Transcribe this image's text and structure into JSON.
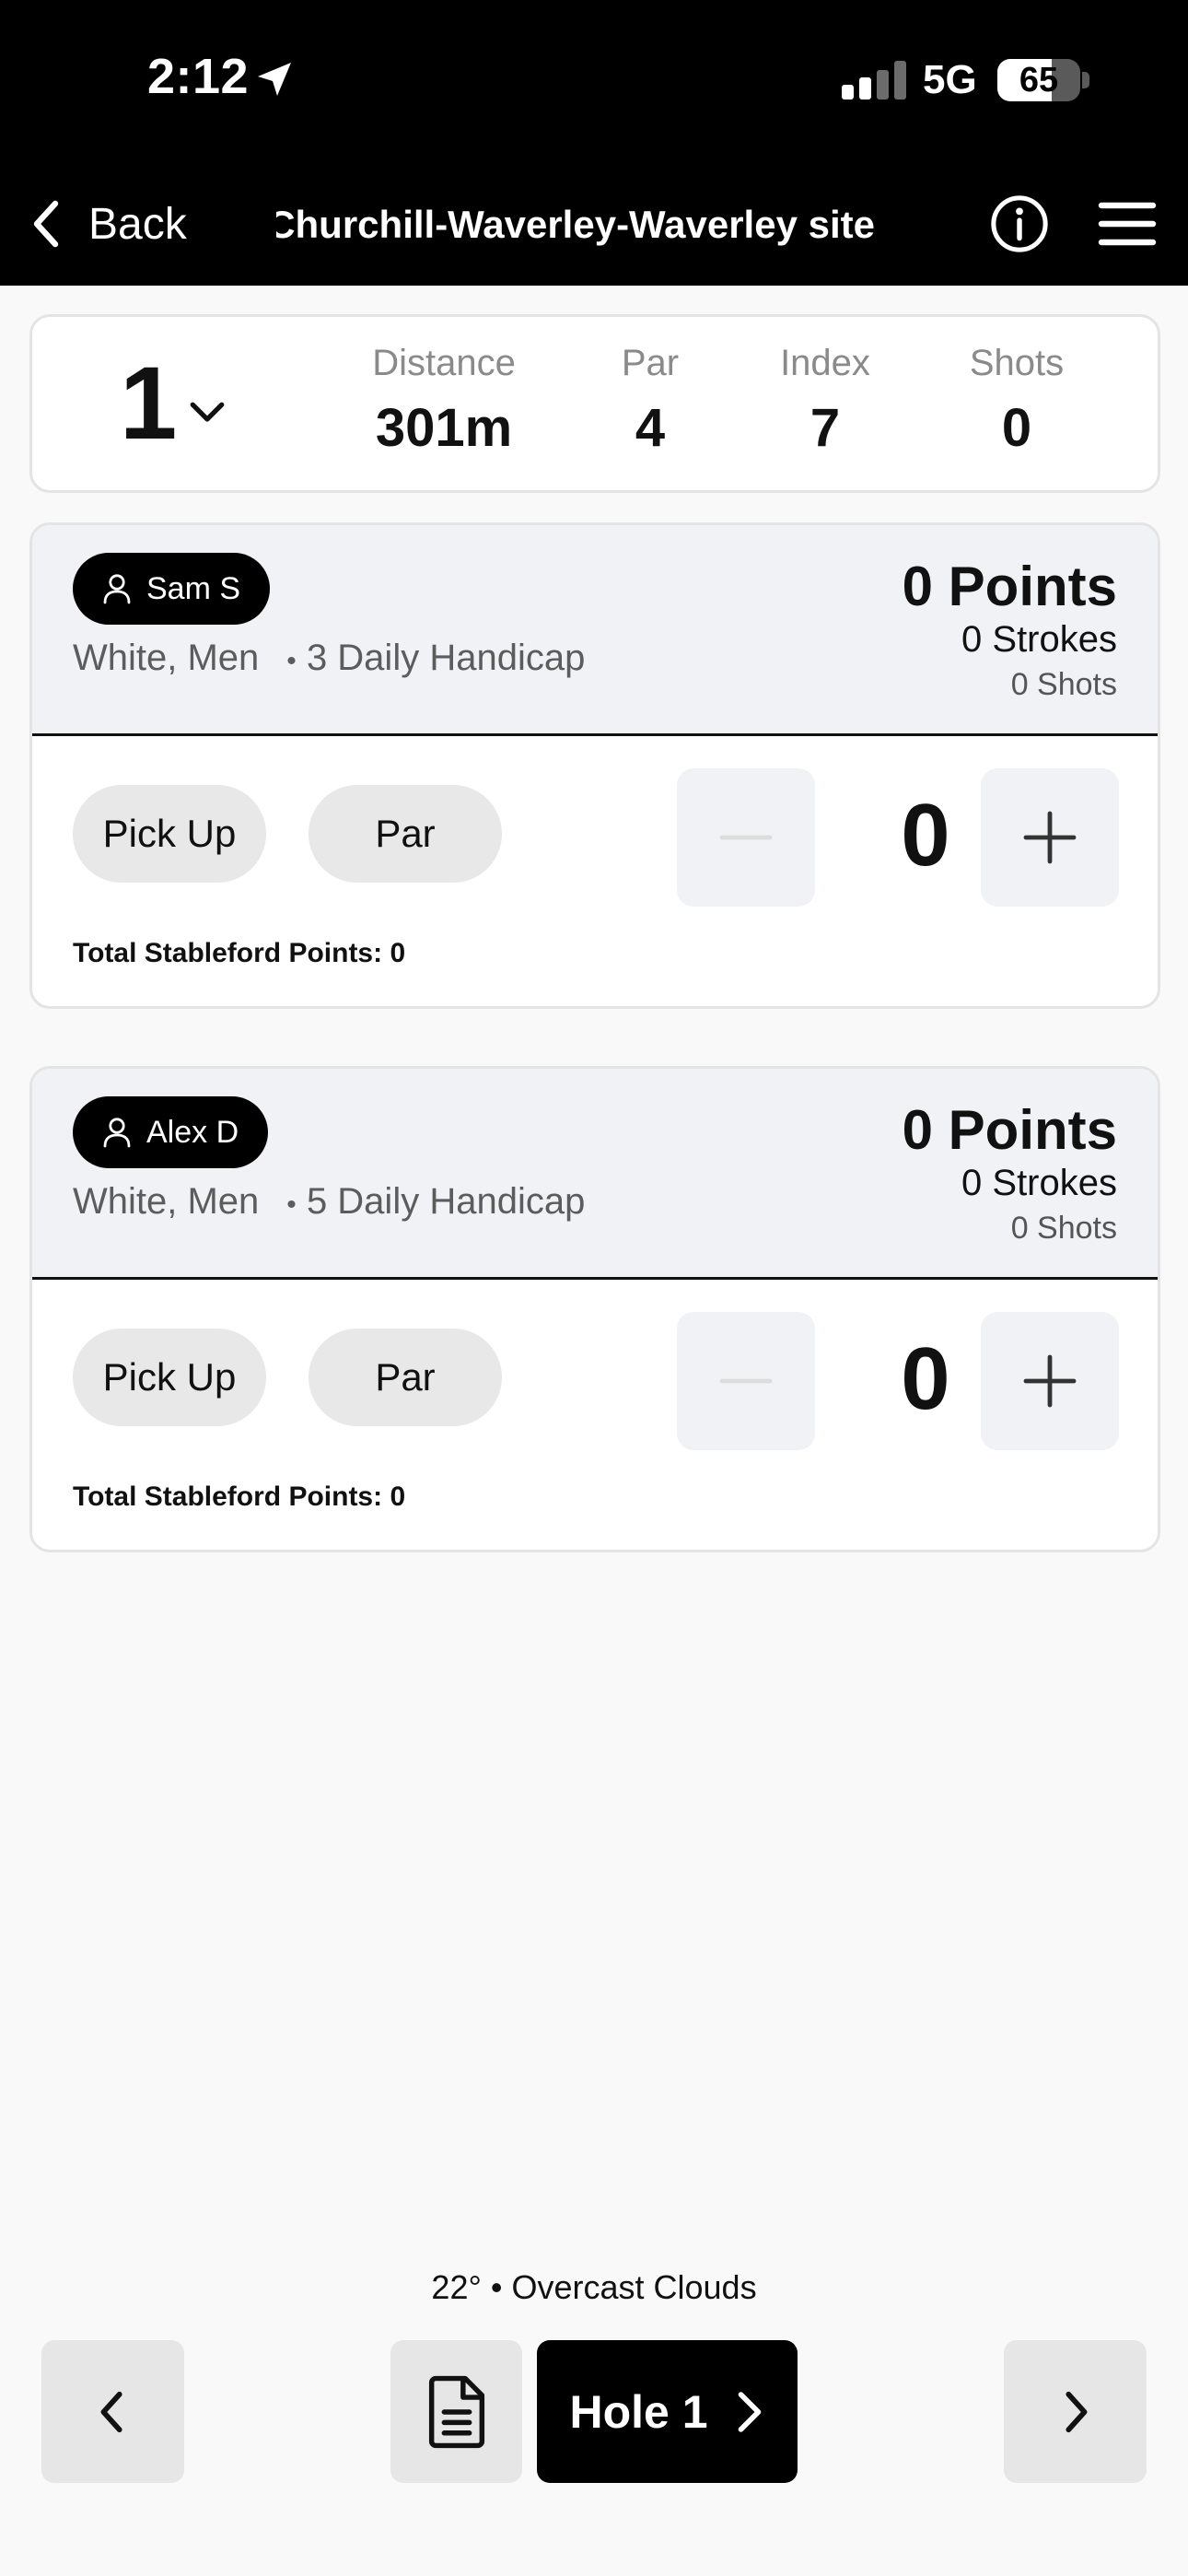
{
  "status_bar": {
    "time": "2:12",
    "network": "5G",
    "battery_percent": "65",
    "battery_level": 0.65,
    "signal_bars_active": 2,
    "signal_bars_total": 4
  },
  "nav": {
    "back_label": "Back",
    "title": "Churchill-Waverley-Waverley site"
  },
  "hole": {
    "number": "1",
    "stats": [
      {
        "label": "Distance",
        "value": "301m"
      },
      {
        "label": "Par",
        "value": "4"
      },
      {
        "label": "Index",
        "value": "7"
      },
      {
        "label": "Shots",
        "value": "0"
      }
    ]
  },
  "players": [
    {
      "name": "Sam S",
      "tee": "White, Men",
      "handicap": "3 Daily Handicap",
      "points": "0 Points",
      "strokes": "0 Strokes",
      "shots": "0 Shots",
      "pick_up_label": "Pick Up",
      "par_label": "Par",
      "score": "0",
      "total_stableford": "Total Stableford Points: 0"
    },
    {
      "name": "Alex D",
      "tee": "White, Men",
      "handicap": "5 Daily Handicap",
      "points": "0 Points",
      "strokes": "0 Strokes",
      "shots": "0 Shots",
      "pick_up_label": "Pick Up",
      "par_label": "Par",
      "score": "0",
      "total_stableford": "Total Stableford Points: 0"
    }
  ],
  "footer": {
    "weather": "22° • Overcast Clouds",
    "next_hole_label": "Hole 1"
  },
  "icons": {
    "back": "chevron-left-icon",
    "info": "info-icon",
    "menu": "hamburger-menu-icon",
    "hole_dropdown": "chevron-down-icon",
    "player": "person-icon",
    "decrement": "minus-icon",
    "increment": "plus-icon",
    "scorecard": "document-icon",
    "prev": "chevron-left-icon",
    "next": "chevron-right-icon"
  },
  "colors": {
    "header_bg": "#000000",
    "page_bg": "#f9f9f9",
    "player_header_bg": "#f1f2f5",
    "pill_bg": "#e8e8e8",
    "accent_dark": "#000000"
  }
}
